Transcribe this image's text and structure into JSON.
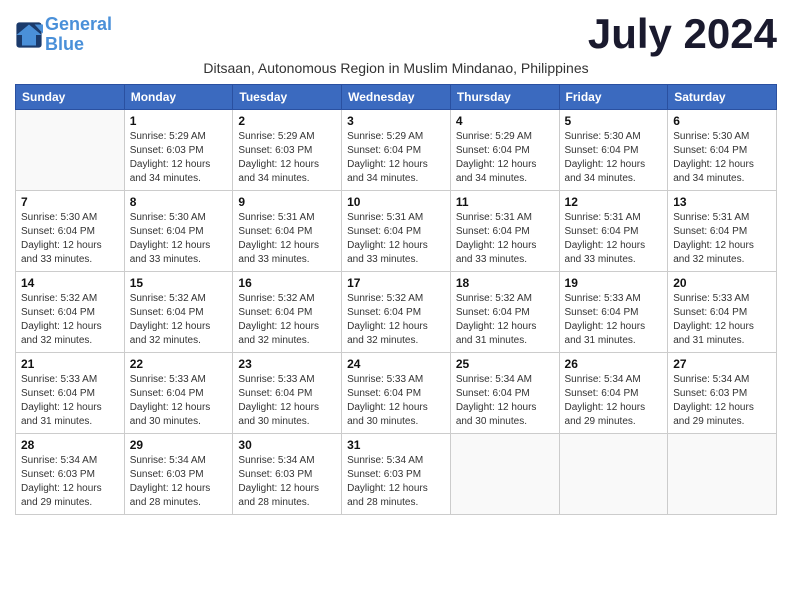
{
  "logo": {
    "line1": "General",
    "line2": "Blue"
  },
  "title": "July 2024",
  "subtitle": "Ditsaan, Autonomous Region in Muslim Mindanao, Philippines",
  "days_of_week": [
    "Sunday",
    "Monday",
    "Tuesday",
    "Wednesday",
    "Thursday",
    "Friday",
    "Saturday"
  ],
  "weeks": [
    [
      {
        "day": "",
        "info": ""
      },
      {
        "day": "1",
        "info": "Sunrise: 5:29 AM\nSunset: 6:03 PM\nDaylight: 12 hours\nand 34 minutes."
      },
      {
        "day": "2",
        "info": "Sunrise: 5:29 AM\nSunset: 6:03 PM\nDaylight: 12 hours\nand 34 minutes."
      },
      {
        "day": "3",
        "info": "Sunrise: 5:29 AM\nSunset: 6:04 PM\nDaylight: 12 hours\nand 34 minutes."
      },
      {
        "day": "4",
        "info": "Sunrise: 5:29 AM\nSunset: 6:04 PM\nDaylight: 12 hours\nand 34 minutes."
      },
      {
        "day": "5",
        "info": "Sunrise: 5:30 AM\nSunset: 6:04 PM\nDaylight: 12 hours\nand 34 minutes."
      },
      {
        "day": "6",
        "info": "Sunrise: 5:30 AM\nSunset: 6:04 PM\nDaylight: 12 hours\nand 34 minutes."
      }
    ],
    [
      {
        "day": "7",
        "info": "Sunrise: 5:30 AM\nSunset: 6:04 PM\nDaylight: 12 hours\nand 33 minutes."
      },
      {
        "day": "8",
        "info": "Sunrise: 5:30 AM\nSunset: 6:04 PM\nDaylight: 12 hours\nand 33 minutes."
      },
      {
        "day": "9",
        "info": "Sunrise: 5:31 AM\nSunset: 6:04 PM\nDaylight: 12 hours\nand 33 minutes."
      },
      {
        "day": "10",
        "info": "Sunrise: 5:31 AM\nSunset: 6:04 PM\nDaylight: 12 hours\nand 33 minutes."
      },
      {
        "day": "11",
        "info": "Sunrise: 5:31 AM\nSunset: 6:04 PM\nDaylight: 12 hours\nand 33 minutes."
      },
      {
        "day": "12",
        "info": "Sunrise: 5:31 AM\nSunset: 6:04 PM\nDaylight: 12 hours\nand 33 minutes."
      },
      {
        "day": "13",
        "info": "Sunrise: 5:31 AM\nSunset: 6:04 PM\nDaylight: 12 hours\nand 32 minutes."
      }
    ],
    [
      {
        "day": "14",
        "info": "Sunrise: 5:32 AM\nSunset: 6:04 PM\nDaylight: 12 hours\nand 32 minutes."
      },
      {
        "day": "15",
        "info": "Sunrise: 5:32 AM\nSunset: 6:04 PM\nDaylight: 12 hours\nand 32 minutes."
      },
      {
        "day": "16",
        "info": "Sunrise: 5:32 AM\nSunset: 6:04 PM\nDaylight: 12 hours\nand 32 minutes."
      },
      {
        "day": "17",
        "info": "Sunrise: 5:32 AM\nSunset: 6:04 PM\nDaylight: 12 hours\nand 32 minutes."
      },
      {
        "day": "18",
        "info": "Sunrise: 5:32 AM\nSunset: 6:04 PM\nDaylight: 12 hours\nand 31 minutes."
      },
      {
        "day": "19",
        "info": "Sunrise: 5:33 AM\nSunset: 6:04 PM\nDaylight: 12 hours\nand 31 minutes."
      },
      {
        "day": "20",
        "info": "Sunrise: 5:33 AM\nSunset: 6:04 PM\nDaylight: 12 hours\nand 31 minutes."
      }
    ],
    [
      {
        "day": "21",
        "info": "Sunrise: 5:33 AM\nSunset: 6:04 PM\nDaylight: 12 hours\nand 31 minutes."
      },
      {
        "day": "22",
        "info": "Sunrise: 5:33 AM\nSunset: 6:04 PM\nDaylight: 12 hours\nand 30 minutes."
      },
      {
        "day": "23",
        "info": "Sunrise: 5:33 AM\nSunset: 6:04 PM\nDaylight: 12 hours\nand 30 minutes."
      },
      {
        "day": "24",
        "info": "Sunrise: 5:33 AM\nSunset: 6:04 PM\nDaylight: 12 hours\nand 30 minutes."
      },
      {
        "day": "25",
        "info": "Sunrise: 5:34 AM\nSunset: 6:04 PM\nDaylight: 12 hours\nand 30 minutes."
      },
      {
        "day": "26",
        "info": "Sunrise: 5:34 AM\nSunset: 6:04 PM\nDaylight: 12 hours\nand 29 minutes."
      },
      {
        "day": "27",
        "info": "Sunrise: 5:34 AM\nSunset: 6:03 PM\nDaylight: 12 hours\nand 29 minutes."
      }
    ],
    [
      {
        "day": "28",
        "info": "Sunrise: 5:34 AM\nSunset: 6:03 PM\nDaylight: 12 hours\nand 29 minutes."
      },
      {
        "day": "29",
        "info": "Sunrise: 5:34 AM\nSunset: 6:03 PM\nDaylight: 12 hours\nand 28 minutes."
      },
      {
        "day": "30",
        "info": "Sunrise: 5:34 AM\nSunset: 6:03 PM\nDaylight: 12 hours\nand 28 minutes."
      },
      {
        "day": "31",
        "info": "Sunrise: 5:34 AM\nSunset: 6:03 PM\nDaylight: 12 hours\nand 28 minutes."
      },
      {
        "day": "",
        "info": ""
      },
      {
        "day": "",
        "info": ""
      },
      {
        "day": "",
        "info": ""
      }
    ]
  ]
}
